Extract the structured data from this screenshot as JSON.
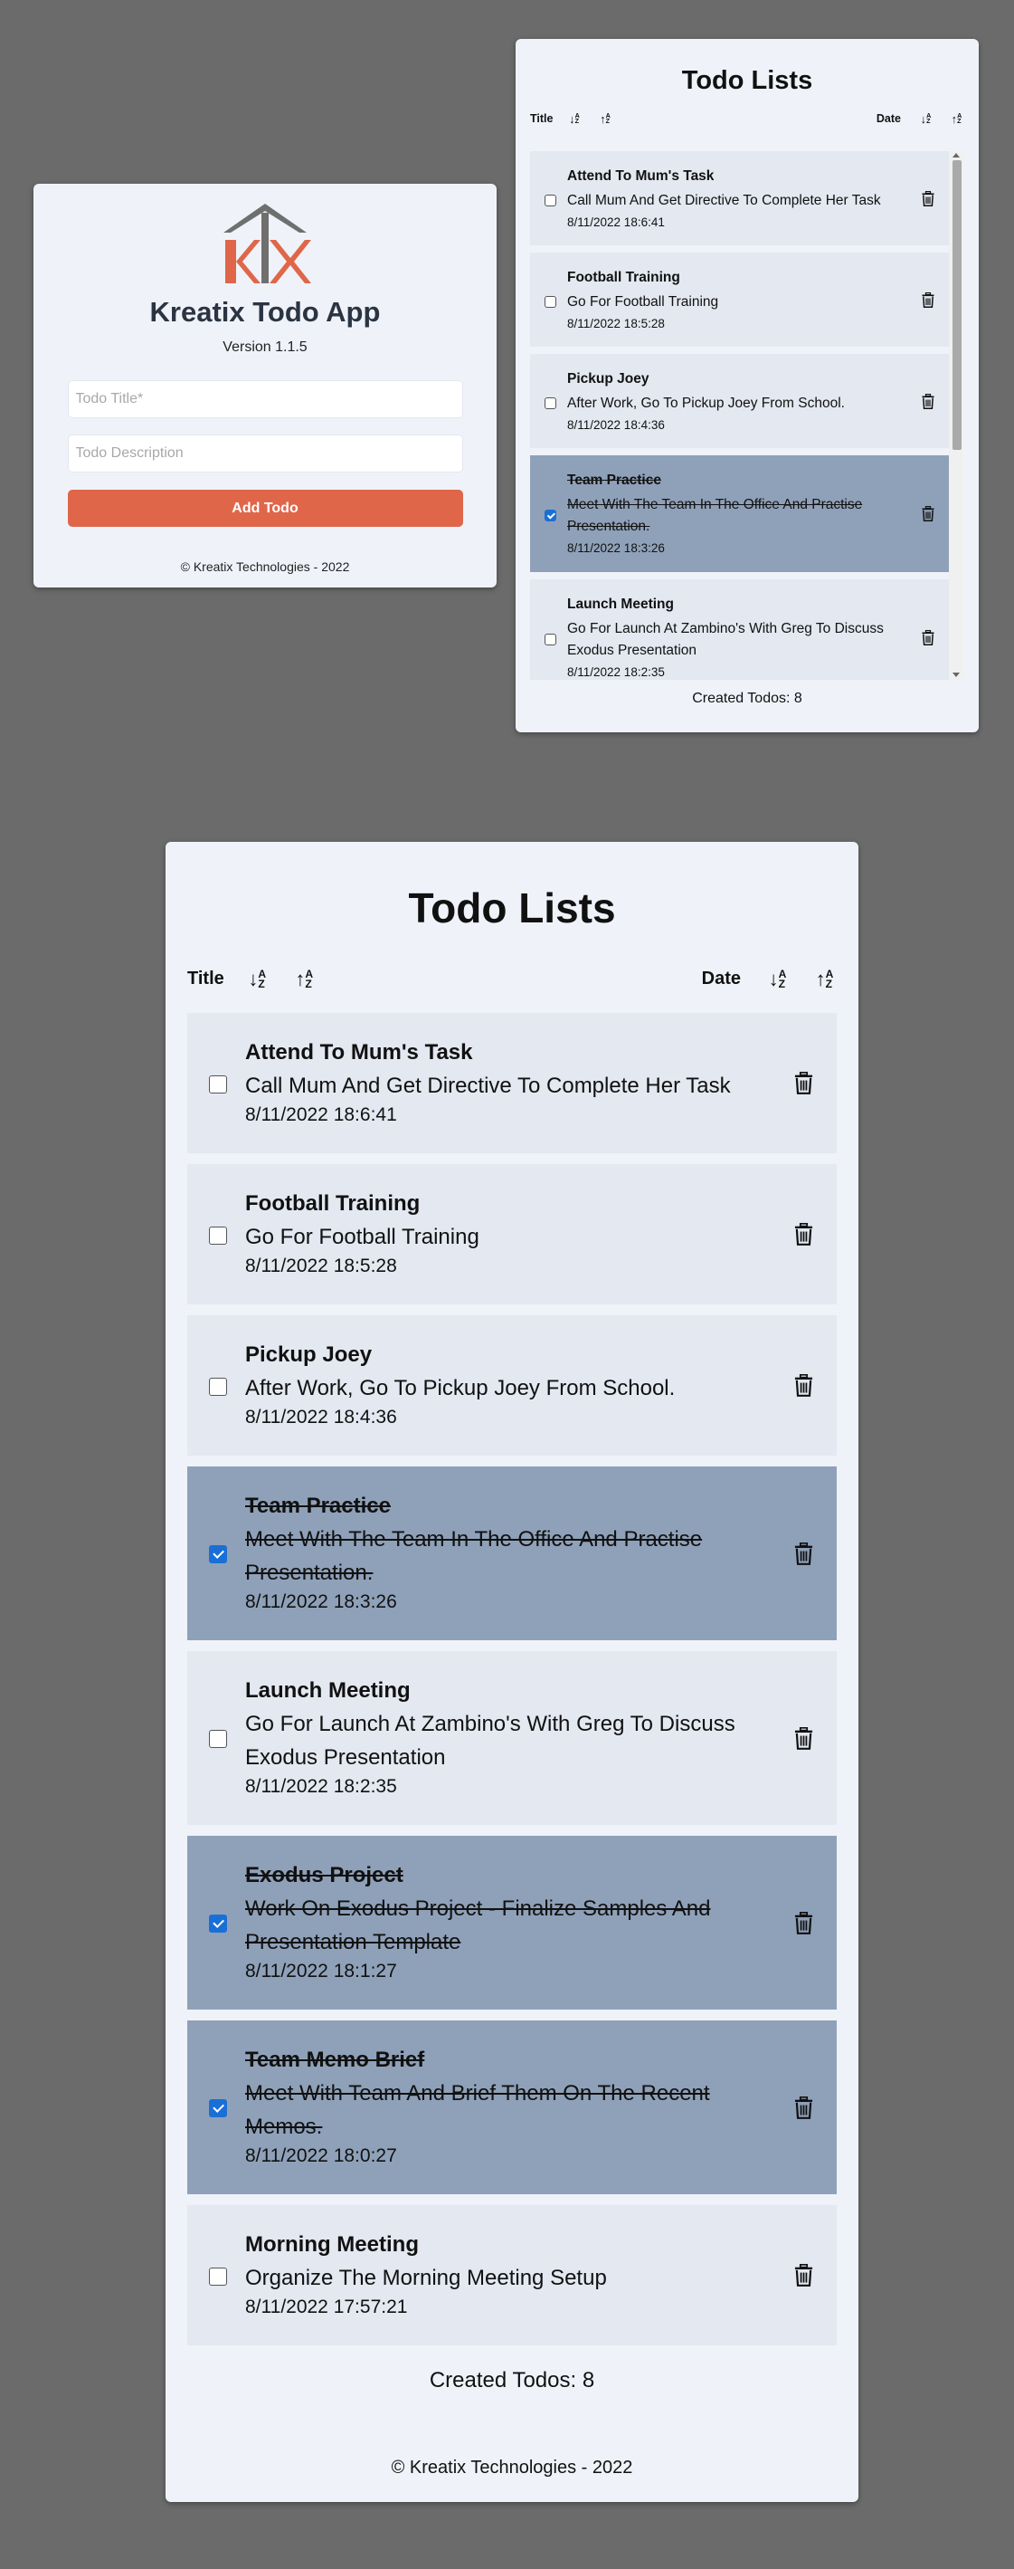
{
  "add_card": {
    "app_title": "Kreatix Todo App",
    "version": "Version 1.1.5",
    "title_placeholder": "Todo Title*",
    "description_placeholder": "Todo Description",
    "add_button": "Add Todo",
    "footer": "© Kreatix Technologies - 2022"
  },
  "colors": {
    "accent": "#e0664a",
    "card_bg": "#eff3f9",
    "item_bg": "#e3e8f1",
    "done_bg": "#8fa1b9",
    "page_bg": "#6b6b6b"
  },
  "sort_bar": {
    "title_label": "Title",
    "date_label": "Date",
    "icons": [
      "sort-desc-az-icon",
      "sort-asc-az-icon"
    ]
  },
  "small_list": {
    "heading": "Todo Lists",
    "count_text": "Created Todos: 8",
    "todos": [
      {
        "title": "Attend To Mum's Task",
        "description": "Call Mum And Get Directive To Complete Her Task",
        "time": "8/11/2022 18:6:41",
        "done": false
      },
      {
        "title": "Football Training",
        "description": "Go For Football Training",
        "time": "8/11/2022 18:5:28",
        "done": false
      },
      {
        "title": "Pickup Joey",
        "description": "After Work, Go To Pickup Joey From School.",
        "time": "8/11/2022 18:4:36",
        "done": false
      },
      {
        "title": "Team Practice",
        "description": "Meet With The Team In The Office And Practise Presentation.",
        "time": "8/11/2022 18:3:26",
        "done": true
      },
      {
        "title": "Launch Meeting",
        "description": "Go For Launch At Zambino's With Greg To Discuss Exodus Presentation",
        "time": "8/11/2022 18:2:35",
        "done": false
      }
    ]
  },
  "large_list": {
    "heading": "Todo Lists",
    "count_text": "Created Todos: 8",
    "footer": "© Kreatix Technologies - 2022",
    "todos": [
      {
        "title": "Attend To Mum's Task",
        "description": "Call Mum And Get Directive To Complete Her Task",
        "time": "8/11/2022 18:6:41",
        "done": false
      },
      {
        "title": "Football Training",
        "description": "Go For Football Training",
        "time": "8/11/2022 18:5:28",
        "done": false
      },
      {
        "title": "Pickup Joey",
        "description": "After Work, Go To Pickup Joey From School.",
        "time": "8/11/2022 18:4:36",
        "done": false
      },
      {
        "title": "Team Practice",
        "description": "Meet With The Team In The Office And Practise Presentation.",
        "time": "8/11/2022 18:3:26",
        "done": true
      },
      {
        "title": "Launch Meeting",
        "description": "Go For Launch At Zambino's With Greg To Discuss Exodus Presentation",
        "time": "8/11/2022 18:2:35",
        "done": false
      },
      {
        "title": "Exodus Project",
        "description": "Work On Exodus Project - Finalize Samples And Presentation Template",
        "time": "8/11/2022 18:1:27",
        "done": true
      },
      {
        "title": "Team Memo Brief",
        "description": "Meet With Team And Brief Them On The Recent Memos.",
        "time": "8/11/2022 18:0:27",
        "done": true
      },
      {
        "title": "Morning Meeting",
        "description": "Organize The Morning Meeting Setup",
        "time": "8/11/2022 17:57:21",
        "done": false
      }
    ]
  }
}
